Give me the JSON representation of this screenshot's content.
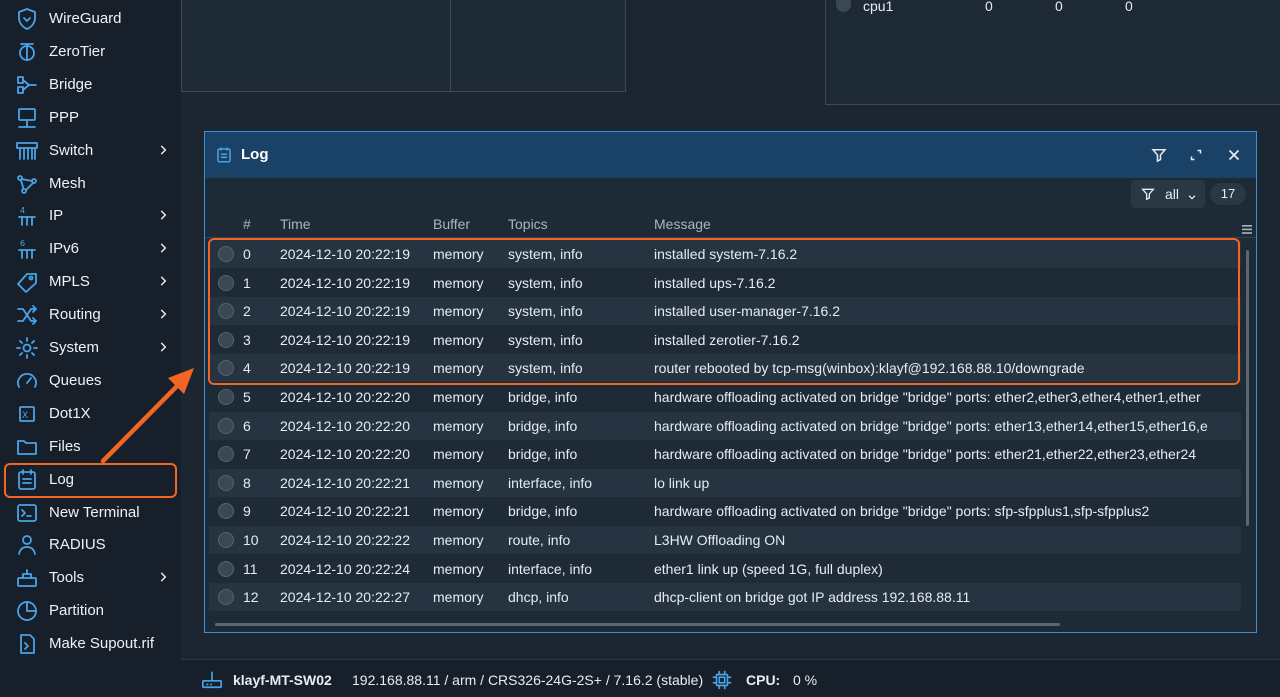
{
  "sidebar": {
    "items": [
      {
        "label": "WireGuard",
        "icon": "wireguard-icon",
        "chevron": false
      },
      {
        "label": "ZeroTier",
        "icon": "zerotier-icon",
        "chevron": false
      },
      {
        "label": "Bridge",
        "icon": "bridge-icon",
        "chevron": false
      },
      {
        "label": "PPP",
        "icon": "ppp-icon",
        "chevron": false
      },
      {
        "label": "Switch",
        "icon": "switch-icon",
        "chevron": true
      },
      {
        "label": "Mesh",
        "icon": "mesh-icon",
        "chevron": false
      },
      {
        "label": "IP",
        "icon": "ip-icon",
        "chevron": true
      },
      {
        "label": "IPv6",
        "icon": "ipv6-icon",
        "chevron": true
      },
      {
        "label": "MPLS",
        "icon": "mpls-icon",
        "chevron": true
      },
      {
        "label": "Routing",
        "icon": "routing-icon",
        "chevron": true
      },
      {
        "label": "System",
        "icon": "system-gear-icon",
        "chevron": true
      },
      {
        "label": "Queues",
        "icon": "queues-icon",
        "chevron": false
      },
      {
        "label": "Dot1X",
        "icon": "dot1x-icon",
        "chevron": false
      },
      {
        "label": "Files",
        "icon": "folder-icon",
        "chevron": false
      },
      {
        "label": "Log",
        "icon": "log-icon",
        "chevron": false,
        "active": true
      },
      {
        "label": "New Terminal",
        "icon": "terminal-icon",
        "chevron": false
      },
      {
        "label": "RADIUS",
        "icon": "radius-icon",
        "chevron": false
      },
      {
        "label": "Tools",
        "icon": "tools-icon",
        "chevron": true
      },
      {
        "label": "Partition",
        "icon": "partition-icon",
        "chevron": false
      },
      {
        "label": "Make Supout.rif",
        "icon": "supout-icon",
        "chevron": false
      }
    ]
  },
  "bg_table": {
    "label": "cpu1",
    "values": [
      "0",
      "0",
      "0"
    ]
  },
  "log_window": {
    "title": "Log",
    "topic_filter": "all",
    "count": "17",
    "columns": {
      "num": "#",
      "time": "Time",
      "buffer": "Buffer",
      "topics": "Topics",
      "message": "Message"
    },
    "rows": [
      {
        "num": "0",
        "time": "2024-12-10 20:22:19",
        "buffer": "memory",
        "topics": "system, info",
        "message": "installed system-7.16.2"
      },
      {
        "num": "1",
        "time": "2024-12-10 20:22:19",
        "buffer": "memory",
        "topics": "system, info",
        "message": "installed ups-7.16.2"
      },
      {
        "num": "2",
        "time": "2024-12-10 20:22:19",
        "buffer": "memory",
        "topics": "system, info",
        "message": "installed user-manager-7.16.2"
      },
      {
        "num": "3",
        "time": "2024-12-10 20:22:19",
        "buffer": "memory",
        "topics": "system, info",
        "message": "installed zerotier-7.16.2"
      },
      {
        "num": "4",
        "time": "2024-12-10 20:22:19",
        "buffer": "memory",
        "topics": "system, info",
        "message": "router rebooted by tcp-msg(winbox):klayf@192.168.88.10/downgrade"
      },
      {
        "num": "5",
        "time": "2024-12-10 20:22:20",
        "buffer": "memory",
        "topics": "bridge, info",
        "message": "hardware offloading activated on bridge \"bridge\" ports: ether2,ether3,ether4,ether1,ether"
      },
      {
        "num": "6",
        "time": "2024-12-10 20:22:20",
        "buffer": "memory",
        "topics": "bridge, info",
        "message": "hardware offloading activated on bridge \"bridge\" ports: ether13,ether14,ether15,ether16,e"
      },
      {
        "num": "7",
        "time": "2024-12-10 20:22:20",
        "buffer": "memory",
        "topics": "bridge, info",
        "message": "hardware offloading activated on bridge \"bridge\" ports: ether21,ether22,ether23,ether24"
      },
      {
        "num": "8",
        "time": "2024-12-10 20:22:21",
        "buffer": "memory",
        "topics": "interface, info",
        "message": "lo link up"
      },
      {
        "num": "9",
        "time": "2024-12-10 20:22:21",
        "buffer": "memory",
        "topics": "bridge, info",
        "message": "hardware offloading activated on bridge \"bridge\" ports: sfp-sfpplus1,sfp-sfpplus2"
      },
      {
        "num": "10",
        "time": "2024-12-10 20:22:22",
        "buffer": "memory",
        "topics": "route, info",
        "message": "L3HW Offloading ON"
      },
      {
        "num": "11",
        "time": "2024-12-10 20:22:24",
        "buffer": "memory",
        "topics": "interface, info",
        "message": "ether1 link up (speed 1G, full duplex)"
      },
      {
        "num": "12",
        "time": "2024-12-10 20:22:27",
        "buffer": "memory",
        "topics": "dhcp, info",
        "message": "dhcp-client on bridge got IP address 192.168.88.11"
      }
    ]
  },
  "statusbar": {
    "identity": "klayf-MT-SW02",
    "details": "192.168.88.11 / arm / CRS326-24G-2S+ / 7.16.2 (stable)",
    "cpu_label": "CPU:",
    "cpu_value": "0 %"
  },
  "colors": {
    "accent": "#3f8fd4",
    "highlight": "#f26522",
    "icon": "#4aa3e8"
  }
}
